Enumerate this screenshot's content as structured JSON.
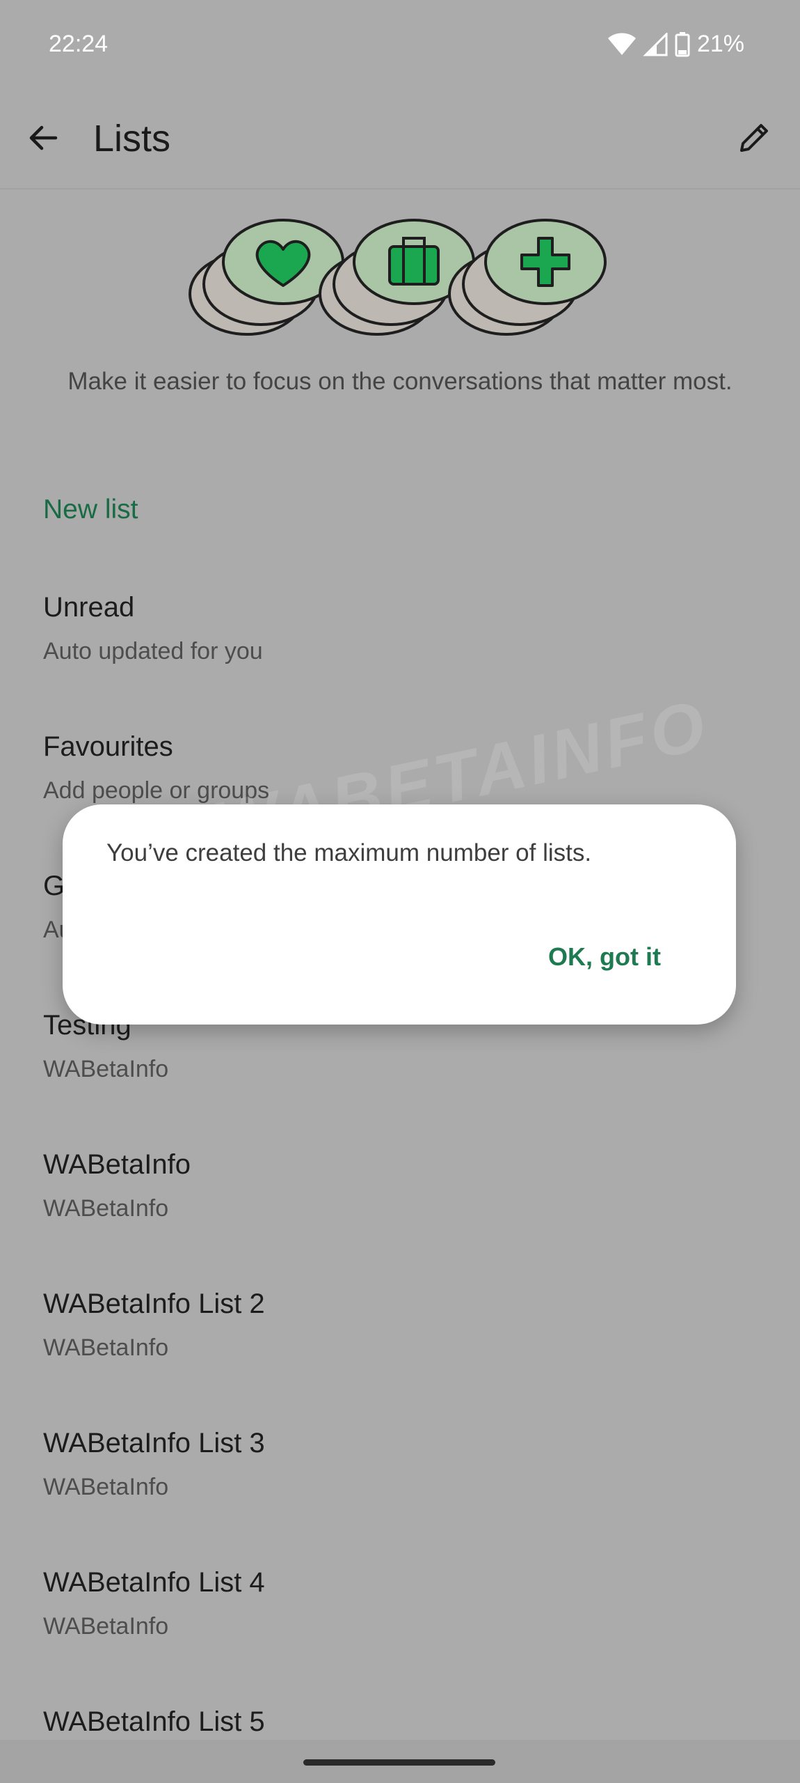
{
  "status_bar": {
    "time": "22:24",
    "battery": "21%",
    "icons": [
      "wifi-icon",
      "signal-icon",
      "battery-icon"
    ]
  },
  "app_bar": {
    "title": "Lists",
    "back_icon": "arrow-left-icon",
    "edit_icon": "pencil-icon"
  },
  "illustration": {
    "icons": [
      "heart-icon",
      "briefcase-icon",
      "plus-icon"
    ]
  },
  "tagline": "Make it easier to focus on the conversations that matter most.",
  "new_list_label": "New list",
  "lists": [
    {
      "title": "Unread",
      "subtitle": "Auto updated for you"
    },
    {
      "title": "Favourites",
      "subtitle": "Add people or groups"
    },
    {
      "title": "G",
      "subtitle": "Au"
    },
    {
      "title": "Testing",
      "subtitle": "WABetaInfo"
    },
    {
      "title": "WABetaInfo",
      "subtitle": "WABetaInfo"
    },
    {
      "title": "WABetaInfo List 2",
      "subtitle": "WABetaInfo"
    },
    {
      "title": "WABetaInfo List 3",
      "subtitle": "WABetaInfo"
    },
    {
      "title": "WABetaInfo List 4",
      "subtitle": "WABetaInfo"
    },
    {
      "title": "WABetaInfo List 5",
      "subtitle": ""
    }
  ],
  "dialog": {
    "message": "You’ve created the maximum number of lists.",
    "ok_label": "OK, got it"
  },
  "watermark": "CWABETAINFO",
  "colors": {
    "accent": "#196b46",
    "scrim": "#ababab",
    "icon_green": "#1aa750",
    "icon_bg": "#aac5a6"
  }
}
